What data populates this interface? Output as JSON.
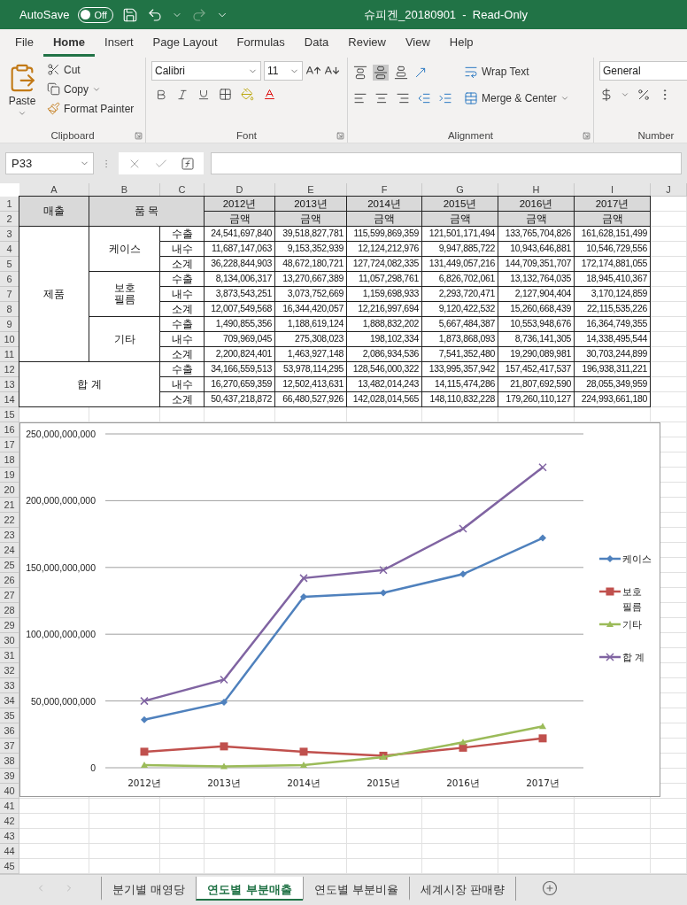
{
  "title_bar": {
    "autosave_label": "AutoSave",
    "autosave_toggle": {
      "label": "Off",
      "on": false
    },
    "title": "슈피겐_20180901  -  Read-Only"
  },
  "menu_tabs": [
    {
      "label": "File",
      "selected": false
    },
    {
      "label": "Home",
      "selected": true
    },
    {
      "label": "Insert",
      "selected": false
    },
    {
      "label": "Page Layout",
      "selected": false
    },
    {
      "label": "Formulas",
      "selected": false
    },
    {
      "label": "Data",
      "selected": false
    },
    {
      "label": "Review",
      "selected": false
    },
    {
      "label": "View",
      "selected": false
    },
    {
      "label": "Help",
      "selected": false
    }
  ],
  "ribbon": {
    "clipboard": {
      "paste": "Paste",
      "cut": "Cut",
      "copy": "Copy",
      "format_painter": "Format Painter",
      "group": "Clipboard"
    },
    "font": {
      "name": "Calibri",
      "size": "11",
      "group": "Font"
    },
    "alignment": {
      "wrap_text": "Wrap Text",
      "merge": "Merge & Center",
      "group": "Alignment"
    },
    "number": {
      "format": "General",
      "group": "Number"
    }
  },
  "formula_bar": {
    "name_box": "P33"
  },
  "columns": [
    "A",
    "B",
    "C",
    "D",
    "E",
    "F",
    "G",
    "H",
    "I",
    "J"
  ],
  "row_numbers": [
    "1",
    "2",
    "3",
    "4",
    "5",
    "6",
    "7",
    "8",
    "9",
    "10",
    "11",
    "12",
    "13",
    "14",
    "15",
    "16",
    "17",
    "18",
    "19",
    "20",
    "21",
    "22",
    "23",
    "24",
    "25",
    "26",
    "27",
    "28",
    "29",
    "30",
    "31",
    "32",
    "33",
    "34",
    "35",
    "36",
    "37",
    "38",
    "39",
    "40",
    "41",
    "42",
    "43",
    "44",
    "45"
  ],
  "table": {
    "header": {
      "sales": "매출",
      "item": "품 목",
      "years": [
        {
          "year": "2012년",
          "sub": "금액"
        },
        {
          "year": "2013년",
          "sub": "금액"
        },
        {
          "year": "2014년",
          "sub": "금액"
        },
        {
          "year": "2015년",
          "sub": "금액"
        },
        {
          "year": "2016년",
          "sub": "금액"
        },
        {
          "year": "2017년",
          "sub": "금액"
        }
      ]
    },
    "groups": [
      {
        "label": "제품",
        "items": [
          {
            "label": "케이스",
            "rows": [
              {
                "label": "수출",
                "values": [
                  "24,541,697,840",
                  "39,518,827,781",
                  "115,599,869,359",
                  "121,501,171,494",
                  "133,765,704,826",
                  "161,628,151,499"
                ]
              },
              {
                "label": "내수",
                "values": [
                  "11,687,147,063",
                  "9,153,352,939",
                  "12,124,212,976",
                  "9,947,885,722",
                  "10,943,646,881",
                  "10,546,729,556"
                ]
              },
              {
                "label": "소계",
                "values": [
                  "36,228,844,903",
                  "48,672,180,721",
                  "127,724,082,335",
                  "131,449,057,216",
                  "144,709,351,707",
                  "172,174,881,055"
                ]
              }
            ]
          },
          {
            "label": "보호\n필름",
            "rows": [
              {
                "label": "수출",
                "values": [
                  "8,134,006,317",
                  "13,270,667,389",
                  "11,057,298,761",
                  "6,826,702,061",
                  "13,132,764,035",
                  "18,945,410,367"
                ]
              },
              {
                "label": "내수",
                "values": [
                  "3,873,543,251",
                  "3,073,752,669",
                  "1,159,698,933",
                  "2,293,720,471",
                  "2,127,904,404",
                  "3,170,124,859"
                ]
              },
              {
                "label": "소계",
                "values": [
                  "12,007,549,568",
                  "16,344,420,057",
                  "12,216,997,694",
                  "9,120,422,532",
                  "15,260,668,439",
                  "22,115,535,226"
                ]
              }
            ]
          },
          {
            "label": "기타",
            "rows": [
              {
                "label": "수출",
                "values": [
                  "1,490,855,356",
                  "1,188,619,124",
                  "1,888,832,202",
                  "5,667,484,387",
                  "10,553,948,676",
                  "16,364,749,355"
                ]
              },
              {
                "label": "내수",
                "values": [
                  "709,969,045",
                  "275,308,023",
                  "198,102,334",
                  "1,873,868,093",
                  "8,736,141,305",
                  "14,338,495,544"
                ]
              },
              {
                "label": "소계",
                "values": [
                  "2,200,824,401",
                  "1,463,927,148",
                  "2,086,934,536",
                  "7,541,352,480",
                  "19,290,089,981",
                  "30,703,244,899"
                ]
              }
            ]
          }
        ]
      }
    ],
    "total": {
      "label": "합 계",
      "rows": [
        {
          "label": "수출",
          "values": [
            "34,166,559,513",
            "53,978,114,295",
            "128,546,000,322",
            "133,995,357,942",
            "157,452,417,537",
            "196,938,311,221"
          ]
        },
        {
          "label": "내수",
          "values": [
            "16,270,659,359",
            "12,502,413,631",
            "13,482,014,243",
            "14,115,474,286",
            "21,807,692,590",
            "28,055,349,959"
          ]
        },
        {
          "label": "소계",
          "values": [
            "50,437,218,872",
            "66,480,527,926",
            "142,028,014,565",
            "148,110,832,228",
            "179,260,110,127",
            "224,993,661,180"
          ]
        }
      ]
    }
  },
  "chart": {
    "chart_data": {
      "type": "line",
      "grid": true,
      "legend": true,
      "categories": [
        "2012년",
        "2013년",
        "2014년",
        "2015년",
        "2016년",
        "2017년"
      ],
      "ylim": [
        0,
        250000000000
      ],
      "yticks": [
        {
          "value": 0,
          "label": "0"
        },
        {
          "value": 50000000000,
          "label": "50,000,000,000"
        },
        {
          "value": 100000000000,
          "label": "100,000,000,000"
        },
        {
          "value": 150000000000,
          "label": "150,000,000,000"
        },
        {
          "value": 200000000000,
          "label": "200,000,000,000"
        },
        {
          "value": 250000000000,
          "label": "250,000,000,000"
        }
      ],
      "series": [
        {
          "name": "케이스",
          "color": "#4f81bd",
          "marker": "diamond",
          "values": [
            36000000000,
            49000000000,
            128000000000,
            131000000000,
            145000000000,
            172000000000
          ]
        },
        {
          "name": "보호\n필름",
          "color": "#c0504d",
          "marker": "square",
          "values": [
            12000000000,
            16000000000,
            12000000000,
            9000000000,
            15000000000,
            22000000000
          ]
        },
        {
          "name": "기타",
          "color": "#9bbb59",
          "marker": "triangle",
          "values": [
            2000000000,
            1000000000,
            2000000000,
            8000000000,
            19000000000,
            31000000000
          ]
        },
        {
          "name": "합 계",
          "color": "#8064a2",
          "marker": "x",
          "values": [
            50000000000,
            66000000000,
            142000000000,
            148000000000,
            179000000000,
            225000000000
          ]
        }
      ]
    }
  },
  "sheet_tabs": [
    {
      "label": "분기별 매영당",
      "selected": false
    },
    {
      "label": "연도별 부분매출",
      "selected": true
    },
    {
      "label": "연도별 부분비율",
      "selected": false
    },
    {
      "label": "세계시장 판매량",
      "selected": false
    }
  ]
}
